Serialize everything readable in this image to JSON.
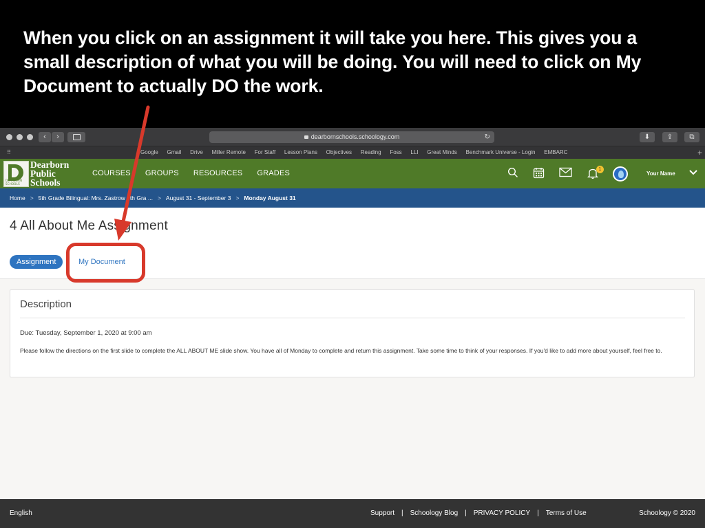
{
  "caption": {
    "text": "When you click on an assignment it will take you here. This gives you a small description of what you will be doing. You will need to click on My Document to actually DO the work."
  },
  "browser": {
    "url": "dearbornschools.schoology.com",
    "bookmarks": [
      "Google",
      "Gmail",
      "Drive",
      "Miller Remote",
      "For Staff",
      "Lesson Plans",
      "Objectives",
      "Reading",
      "Foss",
      "LLI",
      "Great Minds",
      "Benchmark Universe - Login",
      "EMBARC"
    ]
  },
  "header": {
    "district_line1": "Dearborn",
    "district_line2": "Public",
    "district_line3": "Schools",
    "logo_small_text": "DEARBORN SCHOOLS",
    "nav": [
      "COURSES",
      "GROUPS",
      "RESOURCES",
      "GRADES"
    ],
    "notification_count": "1",
    "user_name": "Your Name"
  },
  "breadcrumb": {
    "items": [
      "Home",
      "5th Grade Bilingual: Mrs. Zastrow 5th Gra ...",
      "August 31 - September 3"
    ],
    "current": "Monday August 31",
    "separator": ">"
  },
  "page": {
    "title": "4 All About Me Assignment",
    "tab_assignment": "Assignment",
    "tab_my_document": "My Document"
  },
  "description": {
    "heading": "Description",
    "due": "Due: Tuesday, September 1, 2020 at 9:00 am",
    "body": "Please follow the directions on the first slide to complete the ALL ABOUT ME slide show. You have all of Monday to complete and return this assignment. Take some time to think of your responses. If you'd like to add more about yourself, feel free to."
  },
  "footer": {
    "language": "English",
    "links": [
      "Support",
      "Schoology Blog",
      "PRIVACY POLICY",
      "Terms of Use"
    ],
    "separator": "|",
    "copyright": "Schoology © 2020"
  },
  "colors": {
    "header_green": "#4f7a28",
    "breadcrumb_blue": "#24548b",
    "link_blue": "#2e74c0",
    "annotation_red": "#d8392b"
  }
}
